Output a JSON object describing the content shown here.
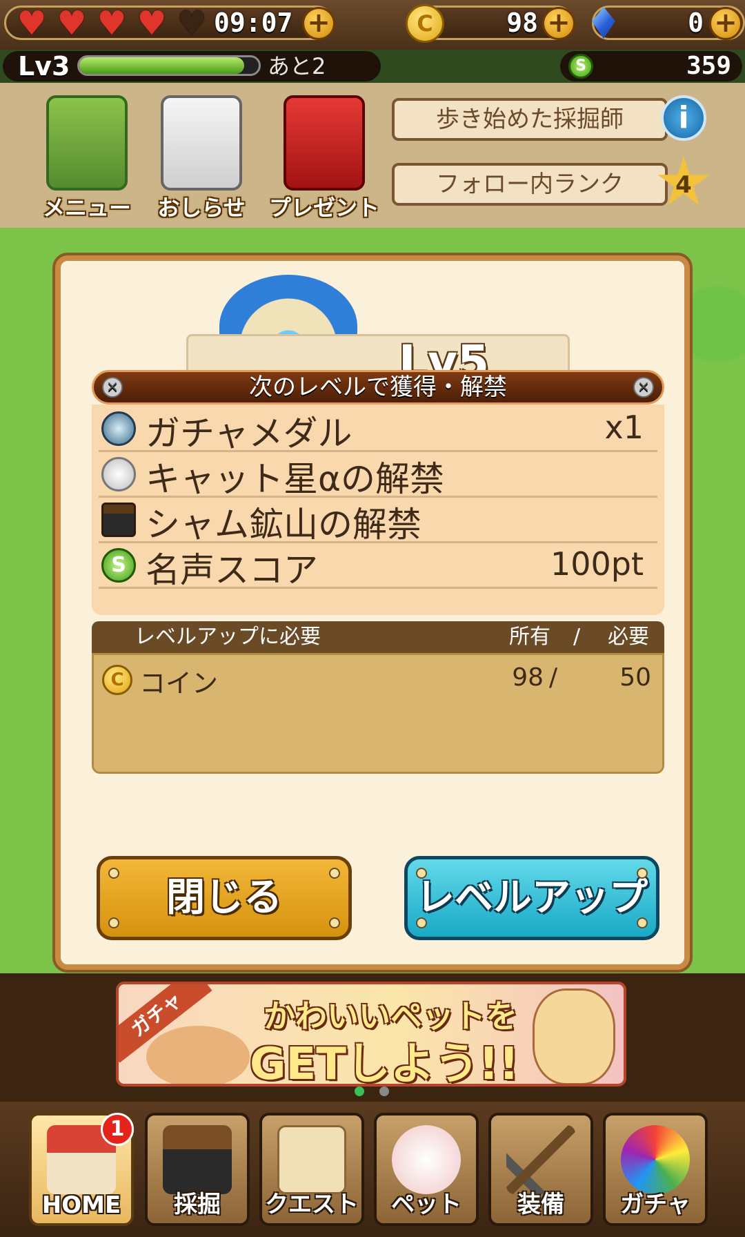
{
  "status_bar": {
    "hearts": {
      "full": 4,
      "total": 5
    },
    "stamina_timer": "09:07",
    "coins": "98",
    "gems": "0"
  },
  "level_bar": {
    "level": "Lv3",
    "remaining": "あと2",
    "exp_progress": 0.92,
    "score": "359"
  },
  "header_menu": {
    "menu": "メニュー",
    "news": "おしらせ",
    "present": "プレゼント",
    "title_banner": "歩き始めた採掘師",
    "rank_banner": "フォロー内ランク",
    "rank_value": "4"
  },
  "modal": {
    "level": "Lv5",
    "rewards_title": "次のレベルで獲得・解禁",
    "rewards": [
      {
        "icon": "gacha-medal-icon",
        "label": "ガチャメダル",
        "value": "x1"
      },
      {
        "icon": "cat-star-icon",
        "label": "キャット星αの解禁",
        "value": ""
      },
      {
        "icon": "mine-icon",
        "label": "シャム鉱山の解禁",
        "value": ""
      },
      {
        "icon": "fame-score-icon",
        "label": "名声スコア",
        "value": "100pt"
      }
    ],
    "requirements": {
      "title": "レベルアップに必要",
      "owned_header": "所有",
      "slash": "/",
      "need_header": "必要",
      "items": [
        {
          "icon": "coin-icon",
          "label": "コイン",
          "owned": "98",
          "need": "50"
        }
      ]
    },
    "close_button": "閉じる",
    "levelup_button": "レベルアップ"
  },
  "promo": {
    "tag": "ガチャ",
    "line1": "かわいいペットを",
    "line2": "GETしよう!!"
  },
  "bottom_nav": [
    {
      "label": "HOME",
      "badge": "1",
      "active": true
    },
    {
      "label": "採掘"
    },
    {
      "label": "クエスト"
    },
    {
      "label": "ペット"
    },
    {
      "label": "装備"
    },
    {
      "label": "ガチャ"
    }
  ],
  "colors": {
    "accent_gold": "#d5920e",
    "accent_cyan": "#19a9c5",
    "heart_red": "#e0352b",
    "badge_red": "#e5231b"
  }
}
